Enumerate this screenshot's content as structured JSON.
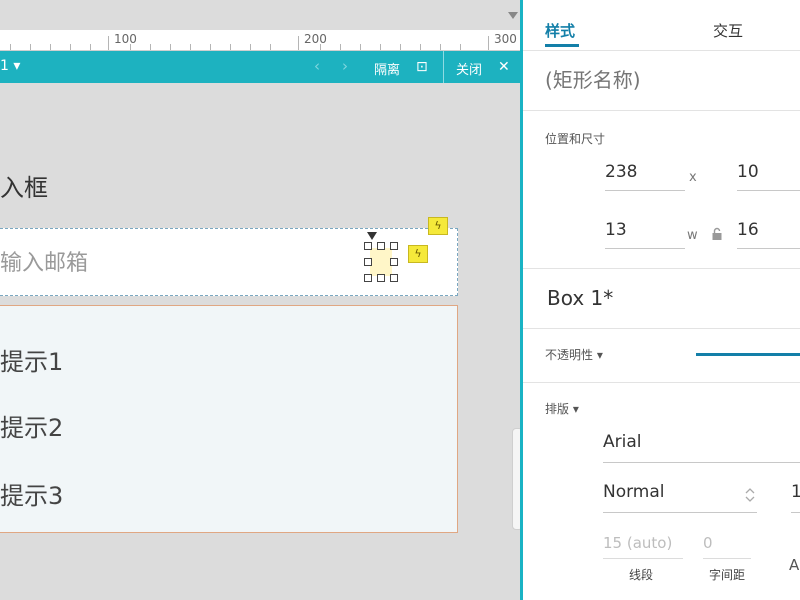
{
  "ruler": {
    "ticks": [
      "100",
      "200",
      "300"
    ]
  },
  "dynamic_panel_bar": {
    "state_label": "1 ▾",
    "prev_icon": "‹",
    "next_icon": "›",
    "isolate_label": "隔离",
    "isolate_icon": "⊡",
    "close_label": "关闭",
    "close_icon": "✕"
  },
  "canvas": {
    "title_label": "入框",
    "email_placeholder": "输入邮箱",
    "email_value": "",
    "interaction_flag": "ϟ",
    "hints": [
      "提示1",
      "提示2",
      "提示3"
    ]
  },
  "panel": {
    "tabs": [
      "样式",
      "交互"
    ],
    "shape_name_placeholder": "(矩形名称)",
    "position_size": {
      "title": "位置和尺寸",
      "x": "238",
      "x_label": "x",
      "y": "10",
      "w": "13",
      "w_label": "w",
      "h": "16",
      "lock_icon": "lock-icon"
    },
    "box_name": "Box 1*",
    "opacity_label": "不透明性 ▾",
    "typography": {
      "title": "排版 ▾",
      "font_family": "Arial",
      "font_weight": "Normal",
      "font_size_partial": "1",
      "line_height_value": "15 (auto)",
      "line_height_label": "线段",
      "letter_spacing_value": "0",
      "letter_spacing_label": "字间距",
      "partial_icon": "A"
    }
  },
  "colors": {
    "accent": "#1db2c0",
    "tab_active": "#137fa8",
    "dropdown_border": "#e0a783",
    "flag": "#f5e93a"
  }
}
